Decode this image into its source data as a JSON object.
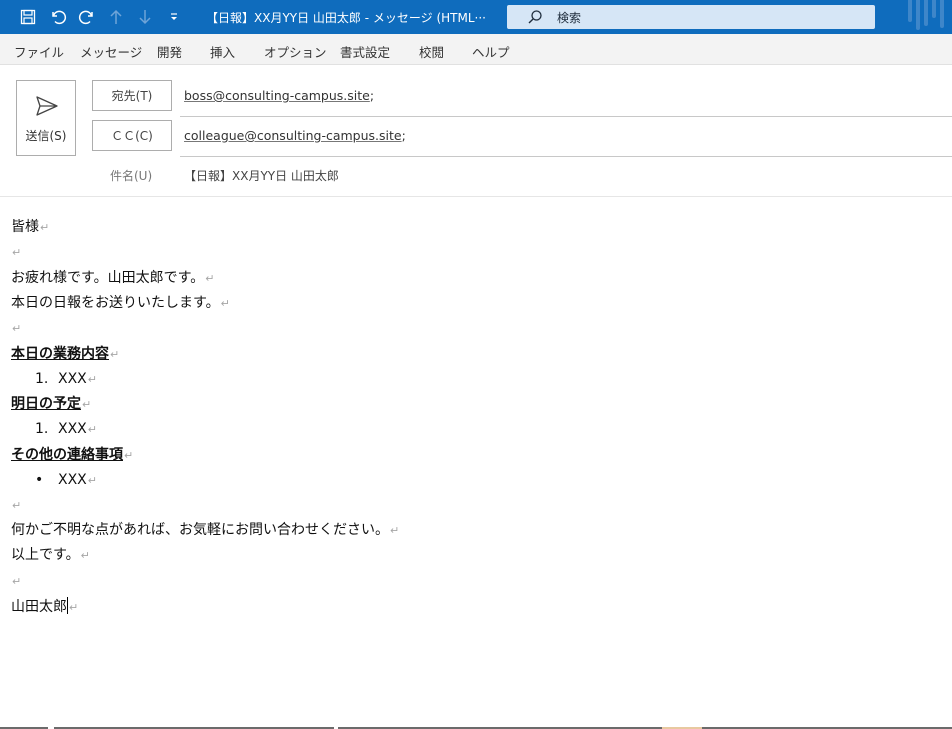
{
  "title_bar": {
    "window_title": "【日報】XX月YY日 山田太郎  -  メッセージ (HTML···",
    "search_placeholder": "検索",
    "icons": [
      "save-icon",
      "undo-icon",
      "redo-icon",
      "arrow-up-icon",
      "arrow-down-icon",
      "customize-icon",
      "search-icon"
    ]
  },
  "menu": {
    "items": [
      "ファイル",
      "メッセージ",
      "開発",
      "挿入",
      "オプション",
      "書式設定",
      "校閲",
      "ヘルプ"
    ]
  },
  "header": {
    "send_label": "送信(S)",
    "to_label": "宛先(T)",
    "to_value": "boss@consulting-campus.site",
    "cc_label": "ＣＣ(C)",
    "cc_value": "colleague@consulting-campus.site",
    "separator": ";",
    "subject_label": "件名(U)",
    "subject_value": "【日報】XX月YY日 山田太郎"
  },
  "body": {
    "greeting": "皆様",
    "intro1": "お疲れ様です。山田太郎です。",
    "intro2": "本日の日報をお送りいたします。",
    "section1_title": "本日の業務内容",
    "section1_num": "1.",
    "section1_item": "XXX",
    "section2_title": "明日の予定",
    "section2_num": "1.",
    "section2_item": "XXX",
    "section3_title": "その他の連絡事項",
    "section3_bullet": "•",
    "section3_item": "XXX",
    "closing1": "何かご不明な点があれば、お気軽にお問い合わせください。",
    "closing2": "以上です。",
    "signature": "山田太郎",
    "paragraph_mark": "↵"
  },
  "colors": {
    "titlebar": "#0f6cbd",
    "search_box": "#d6e6f6",
    "menubar": "#f3f3f3"
  }
}
